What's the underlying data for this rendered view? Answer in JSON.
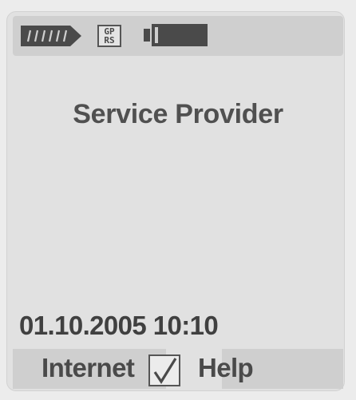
{
  "status_bar": {
    "signal_icon": "signal-strength-icon",
    "gprs_line1": "GP",
    "gprs_line2": "RS",
    "battery_icon": "battery-icon"
  },
  "main": {
    "provider_name": "Service Provider",
    "datetime": "01.10.2005 10:10"
  },
  "softkeys": {
    "left_label": "Internet",
    "center_icon": "checkmark-icon",
    "right_label": "Help"
  },
  "colors": {
    "background": "#ececec",
    "bar": "#cfcfcf",
    "text": "#4a4a4a"
  }
}
